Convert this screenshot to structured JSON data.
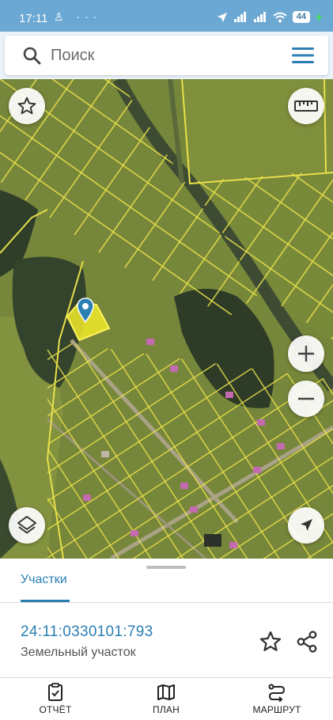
{
  "status_bar": {
    "time": "17:11",
    "left_icons": "♙ ···",
    "battery": "44"
  },
  "search": {
    "placeholder": "Поиск"
  },
  "map": {
    "icons": [
      "star-icon",
      "ruler-icon",
      "zoom-in-icon",
      "zoom-out-icon",
      "layers-icon",
      "location-arrow-icon",
      "map-pin-icon"
    ],
    "colors": {
      "parcel_border": "#e8e04a",
      "selected_parcel": "#f1ea2c",
      "pin": "#2b7fb3"
    }
  },
  "sheet": {
    "tab_label": "Участки",
    "cadastral_number": "24:11:0330101:793",
    "parcel_type": "Земельный участок"
  },
  "nav": {
    "report": "ОТЧЁТ",
    "plan": "ПЛАН",
    "route": "МАРШРУТ"
  }
}
